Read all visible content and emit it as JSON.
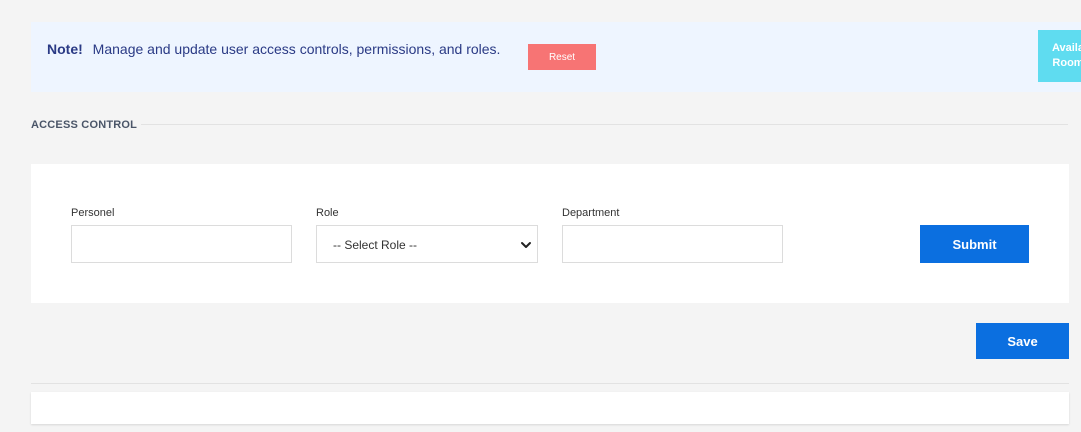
{
  "note": {
    "label": "Note!",
    "message": "Manage and update user access controls, permissions, and roles.",
    "reset_label": "Reset",
    "available_rooms_line1": "Availa",
    "available_rooms_line2": "Room"
  },
  "section": {
    "title": "ACCESS CONTROL"
  },
  "form": {
    "personel_label": "Personel",
    "personel_value": "",
    "role_label": "Role",
    "role_selected": "-- Select Role --",
    "department_label": "Department",
    "department_value": "",
    "submit_label": "Submit"
  },
  "actions": {
    "save_label": "Save"
  },
  "icons": {
    "role_dropdown": "chevron-down-icon"
  },
  "colors": {
    "note_background": "#eef5ff",
    "note_text": "#2a3a85",
    "reset_button": "#f77474",
    "available_rooms_button": "#5fdcf0",
    "primary_button": "#0b6fe0"
  }
}
